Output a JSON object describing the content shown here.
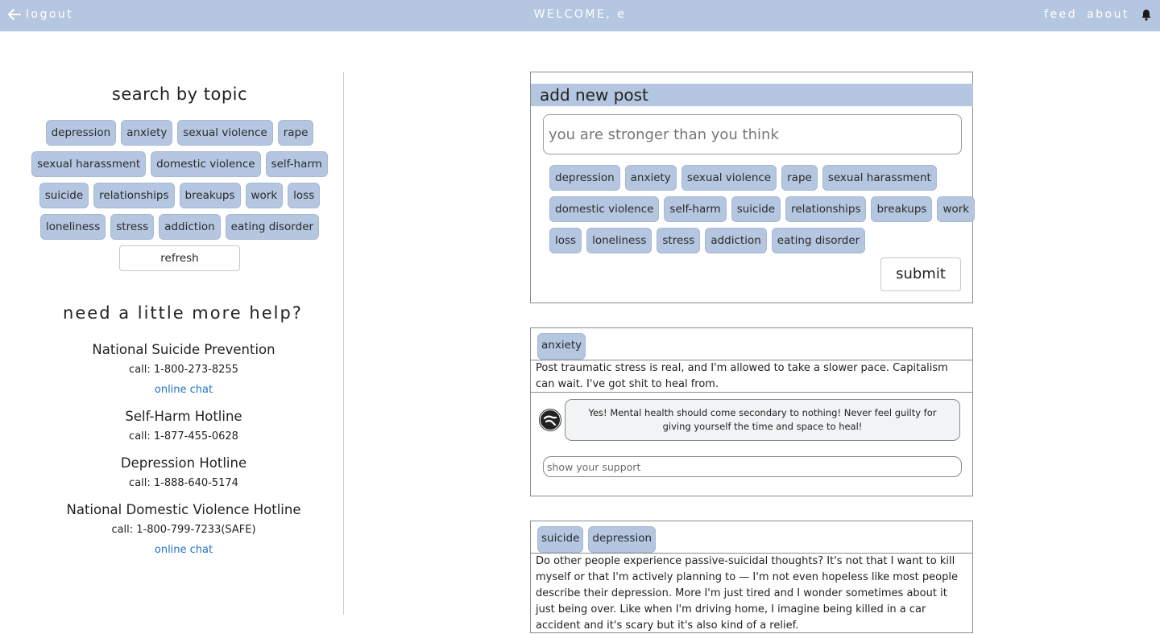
{
  "topbar": {
    "logout": "logout",
    "welcome": "WELCOME, e",
    "feed": "feed",
    "about": "about"
  },
  "sidebar": {
    "topics_title": "search by topic",
    "topic_rows": [
      [
        "depression",
        "anxiety",
        "sexual violence",
        "rape"
      ],
      [
        "sexual harassment",
        "domestic violence",
        "self-harm"
      ],
      [
        "suicide",
        "relationships",
        "breakups",
        "work",
        "loss"
      ],
      [
        "loneliness",
        "stress",
        "addiction",
        "eating disorder"
      ]
    ],
    "refresh": "refresh",
    "help_title": "need a little more help?",
    "hotlines": [
      {
        "name": "National Suicide Prevention",
        "call": "call: 1-800-273-8255",
        "chat": "online chat"
      },
      {
        "name": "Self-Harm Hotline",
        "call": "call: 1-877-455-0628",
        "chat": ""
      },
      {
        "name": "Depression Hotline",
        "call": "call: 1-888-640-5174",
        "chat": ""
      },
      {
        "name": "National Domestic Violence Hotline",
        "call": "call: 1-800-799-7233(SAFE)",
        "chat": "online chat"
      }
    ]
  },
  "new_post": {
    "title": "add new post",
    "placeholder": "you are stronger than you think",
    "tag_rows": [
      [
        "depression",
        "anxiety",
        "sexual violence",
        "rape",
        "sexual harassment"
      ],
      [
        "domestic violence",
        "self-harm",
        "suicide",
        "relationships",
        "breakups",
        "work"
      ],
      [
        "loss",
        "loneliness",
        "stress",
        "addiction",
        "eating disorder"
      ]
    ],
    "submit": "submit"
  },
  "feed": [
    {
      "tags": [
        "anxiety"
      ],
      "body": "Post traumatic stress is real, and I'm allowed to take a slower pace. Capitalism can wait. I've got shit to heal from.",
      "comment": "Yes! Mental health should come secondary to nothing! Never feel guilty for giving yourself the time and space to heal!",
      "support_placeholder": "show your support"
    },
    {
      "tags": [
        "suicide",
        "depression"
      ],
      "body": "Do other people experience passive-suicidal thoughts? It's not that I want to kill myself or that I'm actively planning to — I'm not even hopeless like most people describe their depression. More I'm just tired and I wonder sometimes about it just being over. Like when I'm driving home, I imagine being killed in a car accident and it's scary but it's also kind of a relief."
    }
  ],
  "colors": {
    "accent": "#b4c6e0",
    "link": "#1f73c8"
  }
}
